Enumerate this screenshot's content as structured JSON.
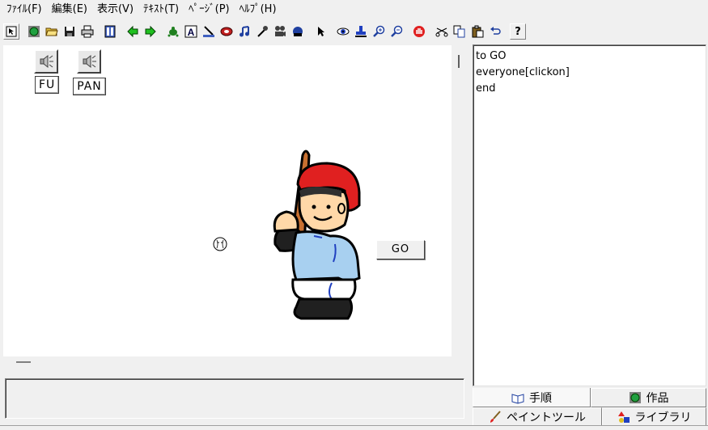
{
  "menu": {
    "items": [
      "ﾌｧｲﾙ(F)",
      "編集(E)",
      "表示(V)",
      "ﾃｷｽﾄ(T)",
      "ﾍﾟｰｼﾞ(P)",
      "ﾍﾙﾌﾟ(H)"
    ]
  },
  "toolbar": {
    "help_glyph": "?"
  },
  "canvas": {
    "speaker_buttons": [
      {
        "label": "FU"
      },
      {
        "label": "PAN"
      }
    ],
    "go_button_label": "GO"
  },
  "procedures": {
    "lines": [
      "to GO",
      "everyone[clickon]",
      "end"
    ]
  },
  "tabs": {
    "procedures": "手順",
    "works": "作品",
    "paint_tool": "ペイントツール",
    "library": "ライブラリ"
  },
  "colors": {
    "helmet": "#e02020",
    "shirt": "#a8d0f0",
    "bat": "#c87030",
    "face": "#ffd8a8"
  }
}
